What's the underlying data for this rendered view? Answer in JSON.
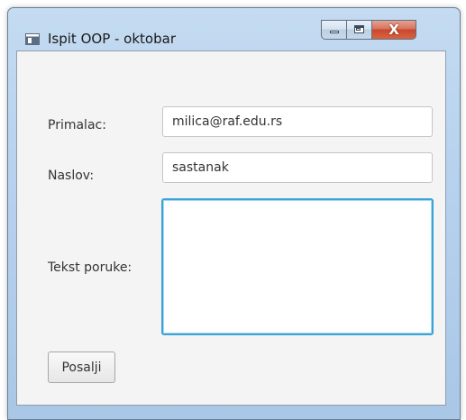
{
  "window": {
    "title": "Ispit OOP - oktobar",
    "controls": {
      "close_glyph": "X"
    }
  },
  "form": {
    "recipient_label": "Primalac:",
    "recipient_value": "milica@raf.edu.rs",
    "subject_label": "Naslov:",
    "subject_value": "sastanak",
    "body_label": "Tekst poruke:",
    "body_value": "",
    "send_button_label": "Posalji"
  },
  "colors": {
    "focus_border": "#3aa3d8",
    "close_button": "#c8482d"
  }
}
